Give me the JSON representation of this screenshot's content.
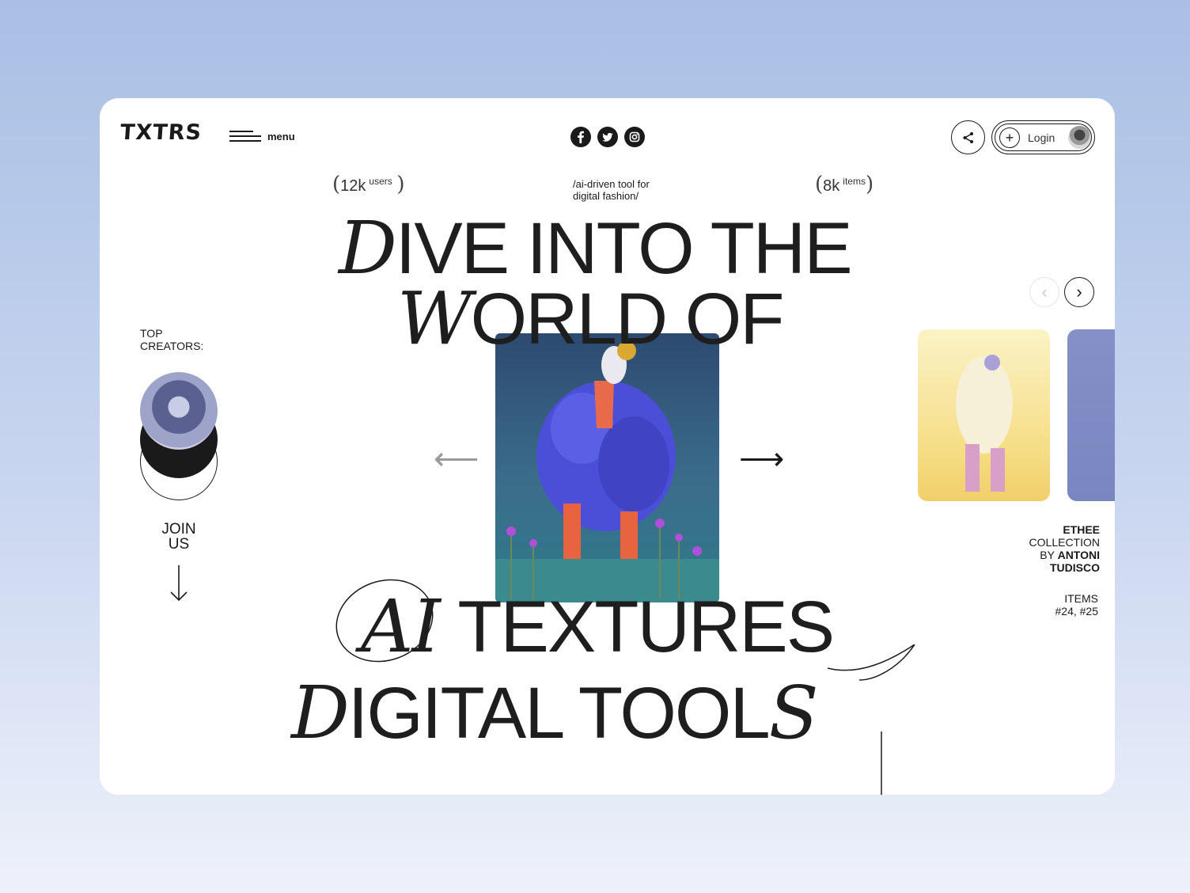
{
  "header": {
    "logo": "TXTRS",
    "menu_label": "menu",
    "socials": [
      "facebook-icon",
      "twitter-icon",
      "instagram-icon"
    ],
    "share_icon": "share-icon",
    "login_label": "Login"
  },
  "stats": {
    "users_value": "12k",
    "users_unit": "users",
    "tagline_line1": "/ai-driven tool for",
    "tagline_line2": "digital fashion/",
    "items_value": "8k",
    "items_unit": "items"
  },
  "headline": {
    "line1_initial": "D",
    "line1_rest": "IVE INTO THE",
    "line2_initial": "W",
    "line2_rest": "ORLD OF",
    "line3_initial": "AI",
    "line3_rest": "TEXTURES",
    "line4_initial": "D",
    "line4_rest": "IGITAL TOOL",
    "line4_final": "S"
  },
  "left": {
    "top_creators_line1": "TOP",
    "top_creators_line2": "CREATORS:",
    "join_line1": "JOIN",
    "join_line2": "US"
  },
  "right": {
    "collection_line1": "ETHEE",
    "collection_line2": "COLLECTION",
    "collection_line3_a": "BY",
    "collection_line3_b": "ANTONI",
    "collection_line4": "TUDISCO",
    "items_line1": "ITEMS",
    "items_line2": "#24, #25"
  },
  "colors": {
    "background_top": "#a9bfe4",
    "card": "#ffffff",
    "ink": "#1a1a1a",
    "hero_coat": "#4a4ad6",
    "thumb_yellow": "#f3d77a"
  }
}
